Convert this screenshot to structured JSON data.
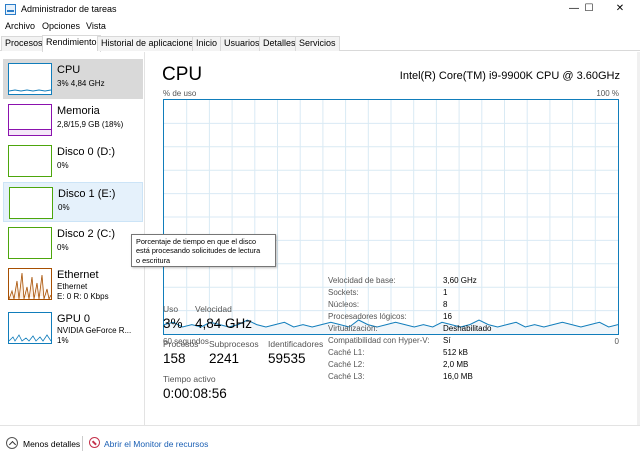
{
  "window": {
    "title": "Administrador de tareas",
    "minimize": "—",
    "maximize": "☐",
    "close": "✕"
  },
  "menu": [
    "Archivo",
    "Opciones",
    "Vista"
  ],
  "tabs": [
    "Procesos",
    "Rendimiento",
    "Historial de aplicaciones",
    "Inicio",
    "Usuarios",
    "Detalles",
    "Servicios"
  ],
  "active_tab": "Rendimiento",
  "sidebar": {
    "items": [
      {
        "title": "CPU",
        "sub": "3% 4,84 GHz",
        "sub2": "",
        "color": "#117dbb"
      },
      {
        "title": "Memoria",
        "sub": "2,8/15,9 GB (18%)",
        "sub2": "",
        "color": "#8b12ae"
      },
      {
        "title": "Disco 0 (D:)",
        "sub": "0%",
        "sub2": "",
        "color": "#4da60c"
      },
      {
        "title": "Disco 1 (E:)",
        "sub": "0%",
        "sub2": "",
        "color": "#4da60c"
      },
      {
        "title": "Disco 2 (C:)",
        "sub": "0%",
        "sub2": "",
        "color": "#4da60c"
      },
      {
        "title": "Ethernet",
        "sub": "Ethernet",
        "sub2": "E: 0 R: 0 Kbps",
        "color": "#a74f01"
      },
      {
        "title": "GPU 0",
        "sub": "NVIDIA GeForce R...",
        "sub2": "1%",
        "color": "#117dbb"
      }
    ]
  },
  "tooltip": {
    "lines": [
      "Porcentaje de tiempo en que el disco",
      "está procesando solicitudes de lectura",
      "o escritura"
    ]
  },
  "main": {
    "title": "CPU",
    "cpu_model": "Intel(R) Core(TM) i9-9900K CPU @ 3.60GHz",
    "graph_top_left": "% de uso",
    "graph_top_right": "100 %",
    "graph_bottom_left": "60 segundos",
    "graph_bottom_right": "0",
    "graph_color": "#117dbb",
    "graph_fill": "#f1f6fa",
    "graph_grid_color": "#d9eaf4",
    "usage_series": [
      4,
      5,
      3,
      4,
      3,
      5,
      4,
      3,
      4,
      6,
      4,
      3,
      4,
      5,
      3,
      4,
      3,
      4,
      5,
      4,
      3,
      6,
      4,
      3,
      4,
      5,
      4,
      3,
      4,
      3,
      5,
      4,
      3,
      4,
      6,
      4,
      3,
      4,
      5,
      3,
      4,
      3,
      4,
      5,
      4,
      3,
      4,
      5,
      3,
      4
    ],
    "stats": {
      "uso_label": "Uso",
      "uso": "3%",
      "velocidad_label": "Velocidad",
      "velocidad": "4,84 GHz",
      "procesos_label": "Procesos",
      "procesos": "158",
      "subprocesos_label": "Subprocesos",
      "subprocesos": "2241",
      "identificadores_label": "Identificadores",
      "identificadores": "59535",
      "tiempo_label": "Tiempo activo",
      "tiempo": "0:00:08:56"
    },
    "specs": [
      {
        "label": "Velocidad de base:",
        "value": "3,60 GHz"
      },
      {
        "label": "Sockets:",
        "value": "1"
      },
      {
        "label": "Núcleos:",
        "value": "8"
      },
      {
        "label": "Procesadores lógicos:",
        "value": "16"
      },
      {
        "label": "Virtualización:",
        "value": "Deshabilitado"
      },
      {
        "label": "Compatibilidad con Hyper-V:",
        "value": "Sí"
      },
      {
        "label": "Caché L1:",
        "value": "512 kB"
      },
      {
        "label": "Caché L2:",
        "value": "2,0 MB"
      },
      {
        "label": "Caché L3:",
        "value": "16,0 MB"
      }
    ]
  },
  "footer": {
    "fewer_details": "Menos detalles",
    "resource_monitor": "Abrir el Monitor de recursos"
  }
}
